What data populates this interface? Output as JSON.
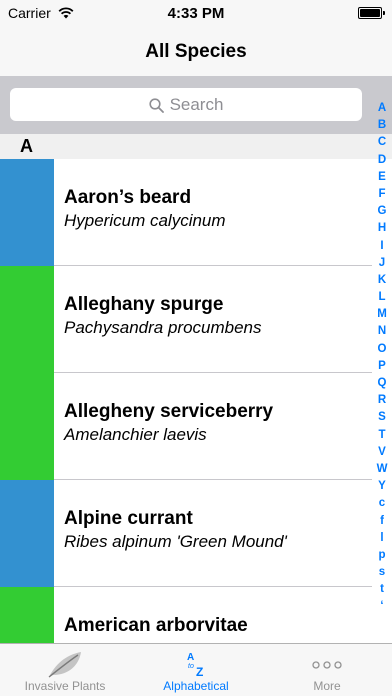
{
  "status_bar": {
    "carrier": "Carrier",
    "time": "4:33 PM"
  },
  "nav": {
    "title": "All Species"
  },
  "search": {
    "placeholder": "Search"
  },
  "section": {
    "letter": "A"
  },
  "colors": {
    "blue": "#3391d0",
    "green": "#33cc33",
    "accent": "#007aff"
  },
  "species": [
    {
      "name": "Aaron’s beard",
      "scientific": "Hypericum calycinum",
      "color": "#3391d0"
    },
    {
      "name": "Alleghany spurge",
      "scientific": "Pachysandra procumbens",
      "color": "#33cc33"
    },
    {
      "name": "Allegheny serviceberry",
      "scientific": "Amelanchier laevis",
      "color": "#33cc33"
    },
    {
      "name": "Alpine currant",
      "scientific": "Ribes alpinum 'Green Mound'",
      "color": "#3391d0"
    },
    {
      "name": "American arborvitae",
      "scientific": "",
      "color": "#33cc33"
    }
  ],
  "index_letters": [
    "A",
    "B",
    "C",
    "D",
    "E",
    "F",
    "G",
    "H",
    "I",
    "J",
    "K",
    "L",
    "M",
    "N",
    "O",
    "P",
    "Q",
    "R",
    "S",
    "T",
    "V",
    "W",
    "Y",
    "c",
    "f",
    "l",
    "p",
    "s",
    "t",
    "‘"
  ],
  "tabs": [
    {
      "label": "Invasive Plants",
      "icon": "leaf-icon",
      "active": false
    },
    {
      "label": "Alphabetical",
      "icon": "a-to-z-icon",
      "active": true
    },
    {
      "label": "More",
      "icon": "more-icon",
      "active": false
    }
  ],
  "az_icon": {
    "top": "A",
    "middle": "to",
    "bottom": "Z"
  }
}
